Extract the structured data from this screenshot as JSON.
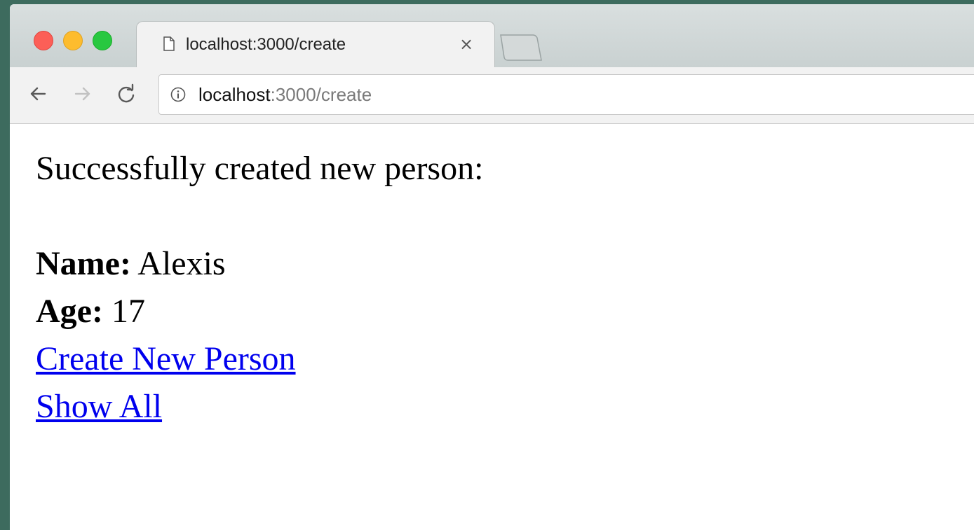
{
  "browser": {
    "tab": {
      "title": "localhost:3000/create",
      "close_glyph": "×",
      "icon": "page-icon"
    },
    "address_bar": {
      "host": "localhost",
      "path": ":3000/create",
      "icon": "info-icon"
    },
    "nav_icons": [
      "back-arrow-icon",
      "forward-arrow-icon",
      "reload-icon"
    ],
    "window_controls": {
      "close_color": "#fc5f57",
      "minimize_color": "#fdbc2e",
      "maximize_color": "#28c840"
    }
  },
  "page": {
    "message": "Successfully created new person:",
    "name_label": "Name:",
    "name_value": " Alexis",
    "age_label": "Age:",
    "age_value": " 17",
    "links": {
      "create_new": "Create New Person",
      "show_all": "Show All"
    },
    "link_color": "#0000ee"
  }
}
